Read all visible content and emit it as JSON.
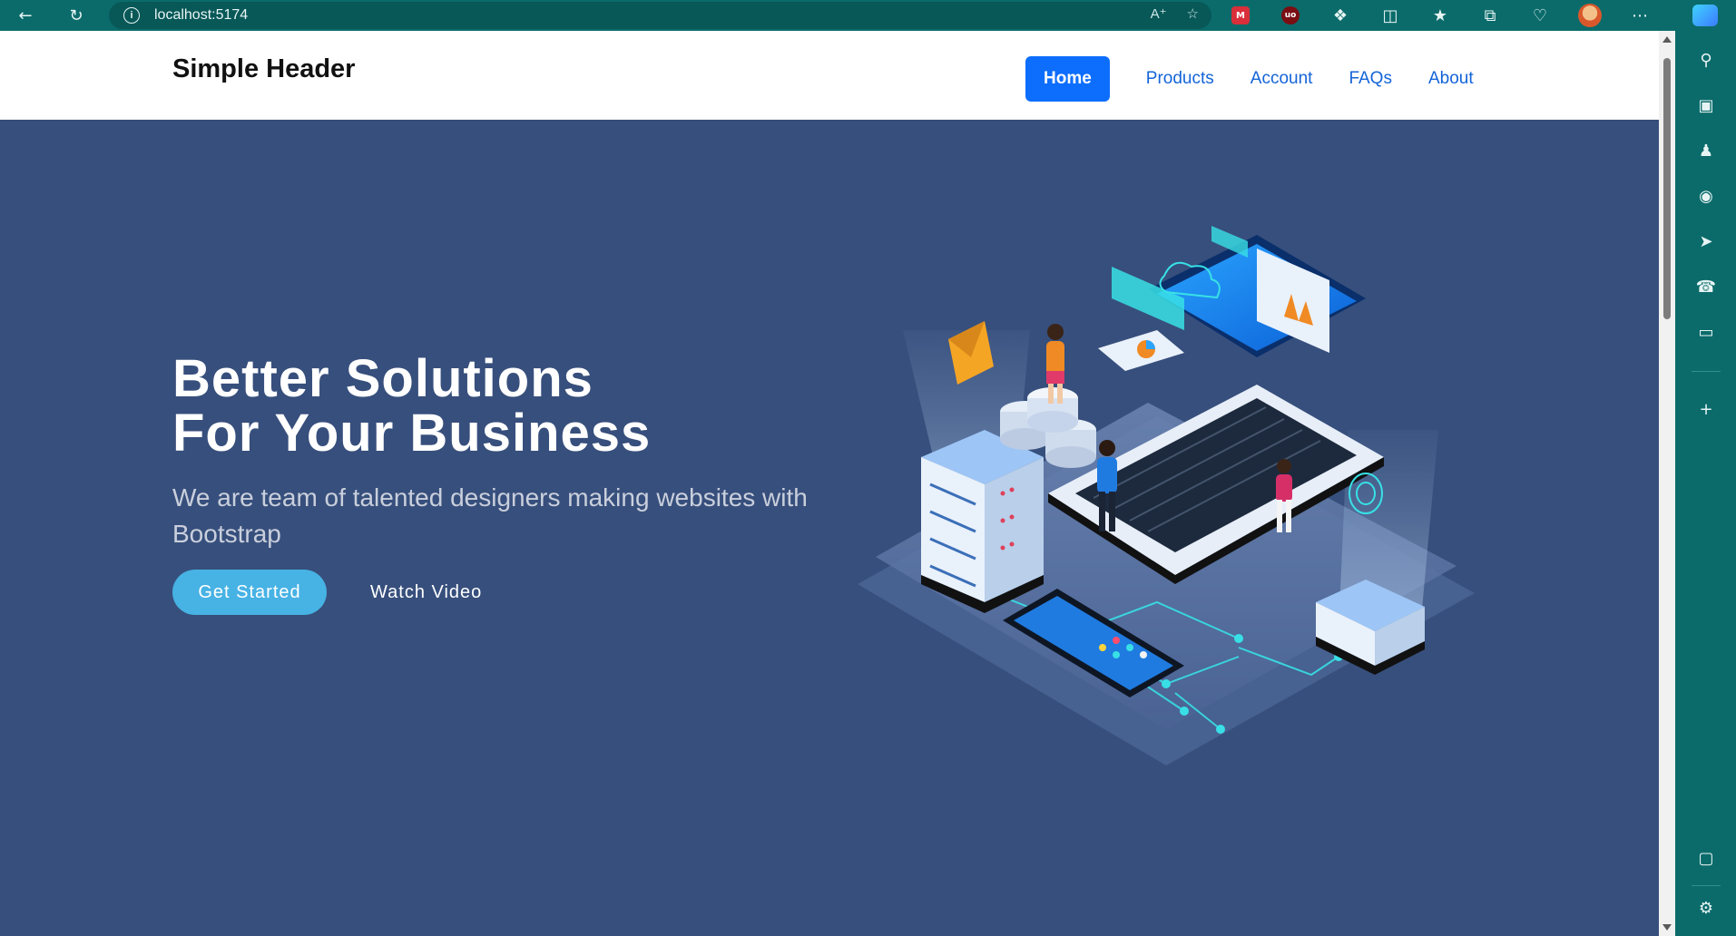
{
  "browser": {
    "url": "localhost:5174"
  },
  "site": {
    "brand": "Simple Header",
    "nav": [
      {
        "label": "Home",
        "active": true
      },
      {
        "label": "Products"
      },
      {
        "label": "Account"
      },
      {
        "label": "FAQs"
      },
      {
        "label": "About"
      }
    ]
  },
  "hero": {
    "title_line1": "Better Solutions",
    "title_line2": "For Your Business",
    "subtitle": "We are team of talented designers making websites with Bootstrap",
    "cta_primary": "Get Started",
    "cta_secondary": "Watch Video"
  },
  "colors": {
    "hero_bg": "#374f7c",
    "primary_nav": "#0d6efd",
    "cta": "#47b2e4",
    "browser_chrome": "#0b6b6b"
  }
}
